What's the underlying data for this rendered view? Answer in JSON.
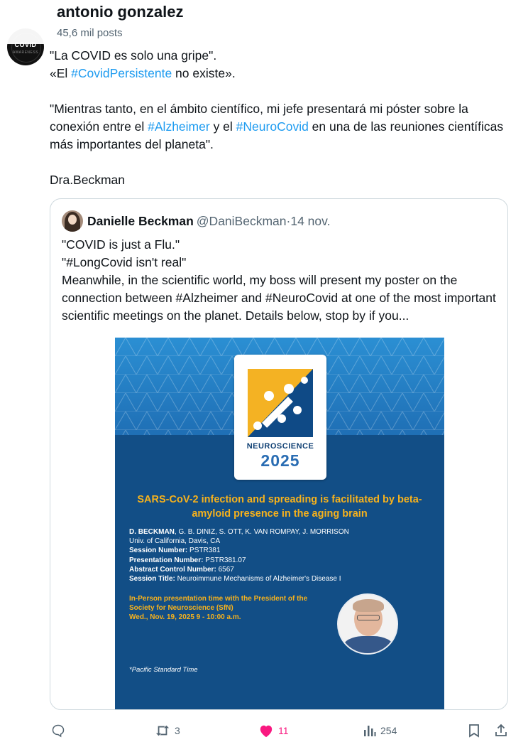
{
  "header": {
    "name": "antonio gonzalez",
    "posts": "45,6 mil posts"
  },
  "avatar": {
    "label": "COVID",
    "sub": "AWARENESS",
    "icon": "covid-awareness-logo"
  },
  "tweet": {
    "line1": "\"La COVID es solo una gripe\".",
    "line2_pre": "«El ",
    "line2_tag": "#CovidPersistente",
    "line2_post": " no existe».",
    "para_pre": "\"Mientras tanto, en el ámbito científico, mi jefe presentará mi póster sobre la conexión entre el ",
    "para_tag1": "#Alzheimer",
    "para_mid": " y el ",
    "para_tag2": "#NeuroCovid",
    "para_post": " en una de las reuniones científicas más importantes del planeta\".",
    "signature": "Dra.Beckman"
  },
  "quote": {
    "name": "Danielle Beckman",
    "handle": "@DaniBeckman",
    "dot": " · ",
    "date": "14 nov.",
    "line1": "\"COVID is just a Flu.\"",
    "line2": "\"#LongCovid isn't real\"",
    "para": "Meanwhile, in the scientific world, my boss will present my poster on the connection between #Alzheimer and #NeuroCovid at one of the most important scientific meetings on the planet. Details below, stop by if you..."
  },
  "poster": {
    "logo_word": "NEUROSCIENCE",
    "logo_year": "2025",
    "title": "SARS-CoV-2 infection and spreading is facilitated by beta-amyloid presence in the aging brain",
    "authors_bold": "D. BECKMAN",
    "authors_rest": ", G. B. DINIZ, S. OTT, K. VAN ROMPAY, J. MORRISON",
    "affiliation": "Univ. of California, Davis, CA",
    "session_number_label": "Session Number:",
    "session_number": " PSTR381",
    "presentation_number_label": "Presentation Number:",
    "presentation_number": " PSTR381.07",
    "abstract_label": "Abstract Control Number:",
    "abstract_number": " 6567",
    "session_title_label": "Session Title:",
    "session_title": " Neuroimmune Mechanisms of Alzheimer's Disease I",
    "inperson_1": "In-Person presentation time with the President of the",
    "inperson_2": "Society for Neuroscience (SfN)",
    "inperson_3": "Wed., Nov. 19, 2025 9 - 10:00 a.m.",
    "footnote": "*Pacific Standard Time",
    "colors": {
      "band": "#2a86c9",
      "body": "#124e86",
      "accent": "#f7b21c"
    }
  },
  "actions": {
    "reply_icon": "reply-icon",
    "repost_icon": "repost-icon",
    "repost_count": "3",
    "like_icon": "heart-icon",
    "like_count": "11",
    "views_icon": "views-icon",
    "views_count": "254",
    "bookmark_icon": "bookmark-icon",
    "share_icon": "share-icon",
    "colors": {
      "like": "#f91880",
      "muted": "#536471"
    }
  }
}
